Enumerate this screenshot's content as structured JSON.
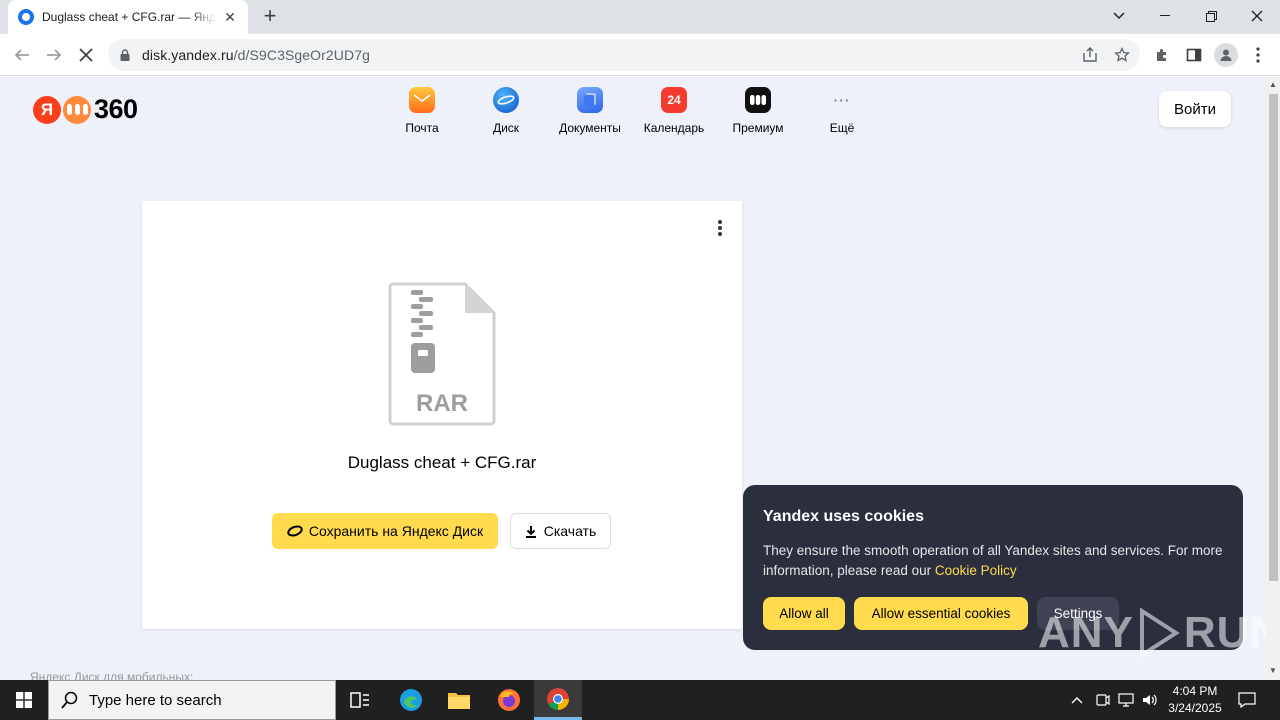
{
  "browser": {
    "tab_title": "Duglass cheat + CFG.rar — Яндекс Диск",
    "tab_close": "✕",
    "new_tab": "+",
    "url_host": "disk.yandex.ru",
    "url_path": "/d/S9C3SgeOr2UD7g"
  },
  "header": {
    "logo_ya": "Я",
    "logo_text": "360",
    "services": [
      {
        "label": "Почта",
        "icon": "mail-icon",
        "color": "#ff9a1f"
      },
      {
        "label": "Диск",
        "icon": "disk-icon",
        "color": "#1a6fe8"
      },
      {
        "label": "Документы",
        "icon": "documents-icon",
        "color": "#3d7ef7"
      },
      {
        "label": "Календарь",
        "icon": "calendar-icon",
        "color": "#f33",
        "badge": "24"
      },
      {
        "label": "Премиум",
        "icon": "premium-icon",
        "color": "#111"
      },
      {
        "label": "Ещё",
        "icon": "more-icon",
        "color": "#888",
        "badge": "···"
      }
    ],
    "login": "Войти"
  },
  "file": {
    "type_label": "RAR",
    "name": "Duglass cheat + CFG.rar",
    "save_label": "Сохранить на Яндекс Диск",
    "download_label": "Скачать"
  },
  "footer": {
    "mobile_text": "Яндекс Диск для мобильных:"
  },
  "cookie": {
    "title": "Yandex uses cookies",
    "text": "They ensure the smooth operation of all Yandex sites and services. For more information, please read our ",
    "link": "Cookie Policy",
    "allow_all": "Allow all",
    "allow_essential": "Allow essential cookies",
    "settings": "Settings"
  },
  "watermark": {
    "left": "ANY",
    "right": "RUN"
  },
  "taskbar": {
    "search_placeholder": "Type here to search",
    "time": "4:04 PM",
    "date": "3/24/2025"
  },
  "colors": {
    "accent_yellow": "#ffdb4d",
    "cookie_bg": "#2b2e3d",
    "page_bg": "#eef1f9"
  }
}
